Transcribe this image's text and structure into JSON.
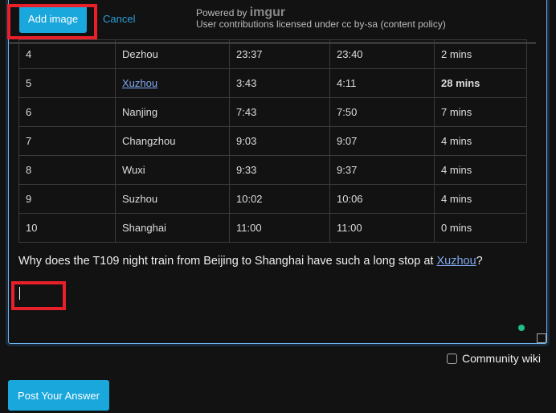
{
  "toolbar": {
    "add_image": "Add image",
    "cancel": "Cancel",
    "powered_by": "Powered by ",
    "imgur": "imgur",
    "license": "User contributions licensed under cc by-sa (content policy)"
  },
  "table": {
    "rows": [
      [
        "4",
        "Dezhou",
        "23:37",
        "23:40",
        "2 mins"
      ],
      [
        "5",
        "Xuzhou",
        "3:43",
        "4:11",
        "28 mins"
      ],
      [
        "6",
        "Nanjing",
        "7:43",
        "7:50",
        "7 mins"
      ],
      [
        "7",
        "Changzhou",
        "9:03",
        "9:07",
        "4 mins"
      ],
      [
        "8",
        "Wuxi",
        "9:33",
        "9:37",
        "4 mins"
      ],
      [
        "9",
        "Suzhou",
        "10:02",
        "10:06",
        "4 mins"
      ],
      [
        "10",
        "Shanghai",
        "11:00",
        "11:00",
        "0 mins"
      ]
    ]
  },
  "question": {
    "before": "Why does the T109 night train from Beijing to Shanghai have such a long stop at ",
    "link": "Xuzhou",
    "after": "?"
  },
  "community_wiki": "Community wiki",
  "post_button": "Post Your Answer",
  "colors": {
    "accent": "#1aa7dc",
    "annotation": "#e8202a",
    "link": "#7fa8ee"
  }
}
